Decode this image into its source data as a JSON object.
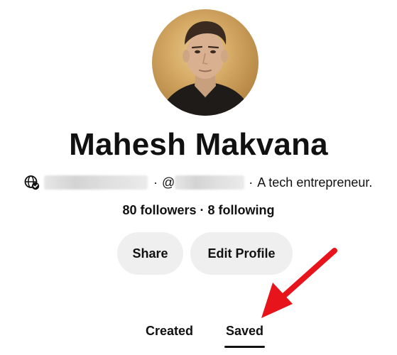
{
  "profile": {
    "name": "Mahesh Makvana",
    "bio_separator_1": "·",
    "handle_prefix": "@",
    "bio_separator_2": "·",
    "bio_text": "A tech entrepreneur.",
    "stats": "80 followers · 8 following"
  },
  "actions": {
    "share_label": "Share",
    "edit_label": "Edit Profile"
  },
  "tabs": [
    {
      "label": "Created",
      "selected": false
    },
    {
      "label": "Saved",
      "selected": true
    }
  ],
  "icons": {
    "globe": "globe-verified-icon",
    "annotation": "red-arrow-annotation"
  },
  "colors": {
    "button_bg": "#efefef",
    "text": "#111111",
    "annotation_arrow": "#e8141b"
  }
}
